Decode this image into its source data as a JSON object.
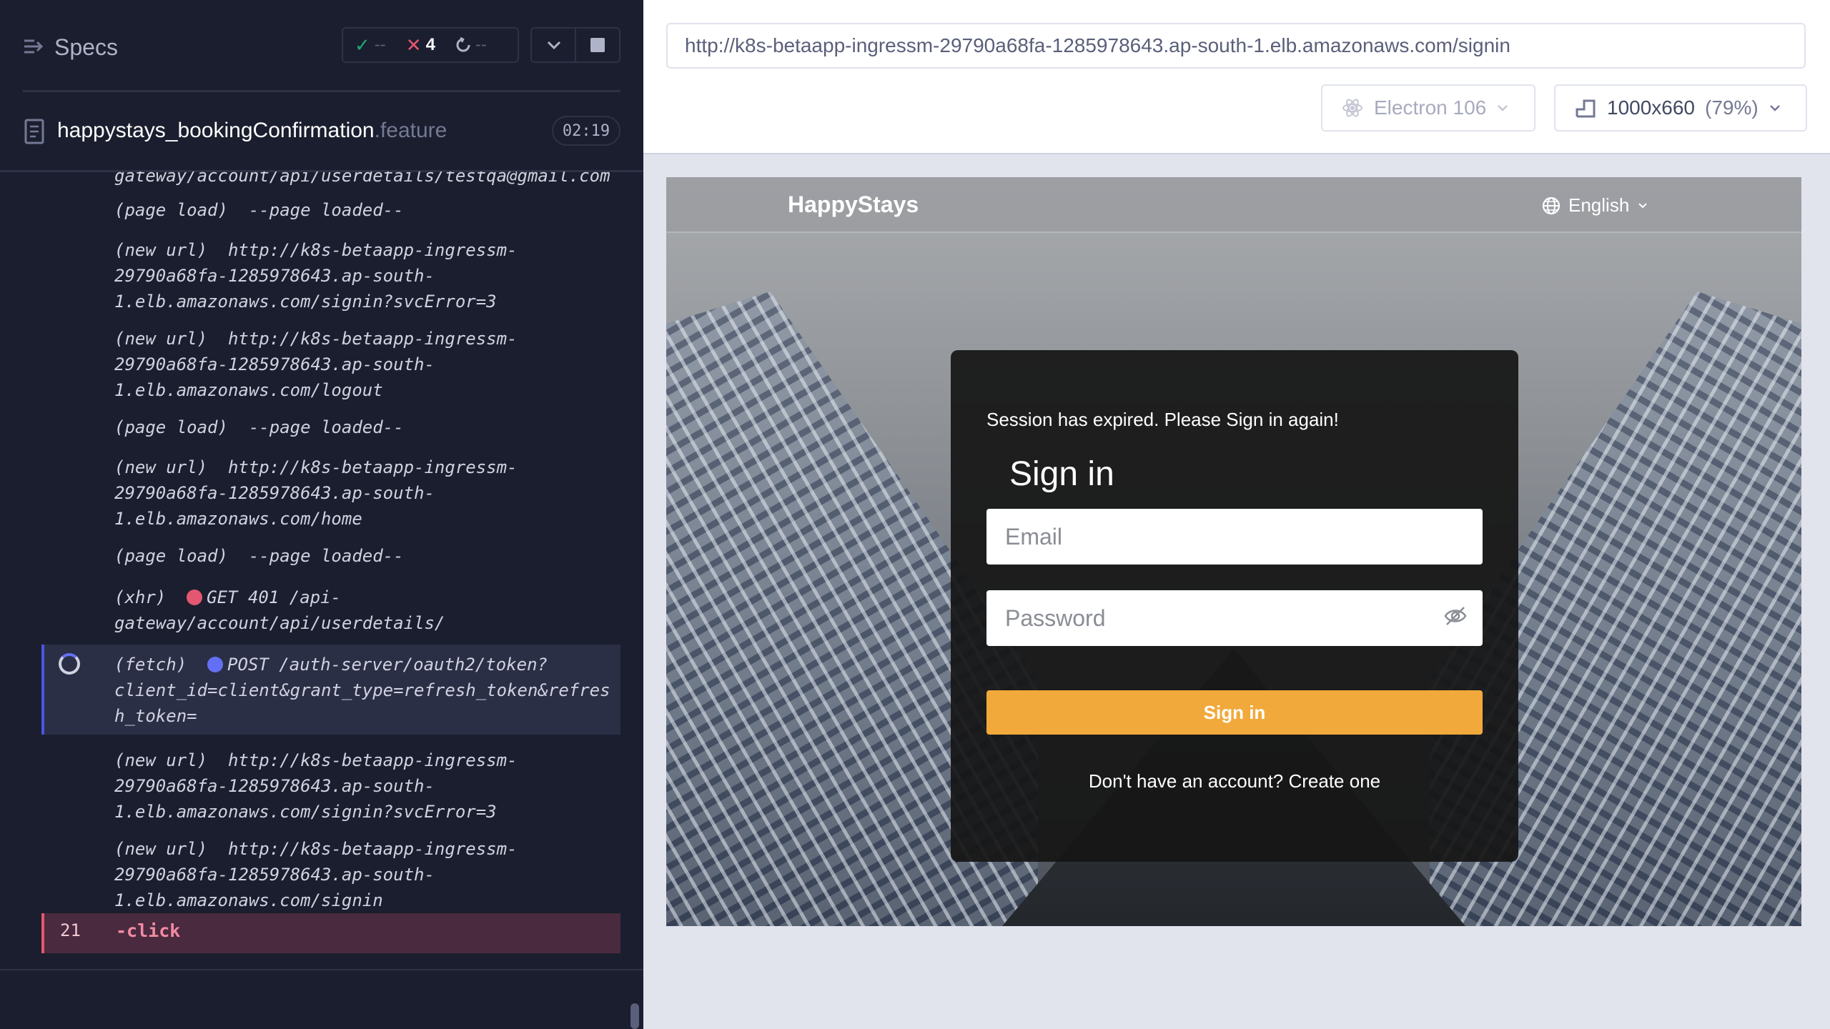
{
  "reporter": {
    "title": "Specs",
    "stats": {
      "passed": "--",
      "failed": "4",
      "pending": "--"
    },
    "spec": {
      "name": "happystays_bookingConfirmation",
      "ext": ".feature",
      "duration": "02:19"
    },
    "log": [
      {
        "text": "gateway/account/api/userdetails/testqa@gmail.com"
      },
      {
        "text": "(page load)  --page loaded--"
      },
      {
        "text": "(new url)  http://k8s-betaapp-ingressm-\n29790a68fa-1285978643.ap-south-\n1.elb.amazonaws.com/signin?svcError=3"
      },
      {
        "text": "(new url)  http://k8s-betaapp-ingressm-\n29790a68fa-1285978643.ap-south-\n1.elb.amazonaws.com/logout"
      },
      {
        "text": "(page load)  --page loaded--"
      },
      {
        "text": "(new url)  http://k8s-betaapp-ingressm-\n29790a68fa-1285978643.ap-south-\n1.elb.amazonaws.com/home"
      },
      {
        "text": "(page load)  --page loaded--"
      },
      {
        "prefix": "(xhr)  ",
        "text": "GET 401 /api-\ngateway/account/api/userdetails/"
      },
      {
        "prefix": "(fetch)  ",
        "text": "POST /auth-server/oauth2/token?\nclient_id=client&grant_type=refresh_token&refres\nh_token="
      },
      {
        "text": "(new url)  http://k8s-betaapp-ingressm-\n29790a68fa-1285978643.ap-south-\n1.elb.amazonaws.com/signin?svcError=3"
      },
      {
        "text": "(new url)  http://k8s-betaapp-ingressm-\n29790a68fa-1285978643.ap-south-\n1.elb.amazonaws.com/signin"
      }
    ],
    "current": {
      "line": "21",
      "command": "-click"
    }
  },
  "aut_header": {
    "url": "http://k8s-betaapp-ingressm-29790a68fa-1285978643.ap-south-1.elb.amazonaws.com/signin",
    "browser": "Electron 106",
    "viewport": "1000x660",
    "scale": "(79%)"
  },
  "app": {
    "brand": "HappyStays",
    "language": "English",
    "session_message": "Session has expired. Please Sign in again!",
    "heading": "Sign in",
    "email_placeholder": "Email",
    "password_placeholder": "Password",
    "submit_label": "Sign in",
    "signup_text": "Don't have an account? Create one"
  },
  "colors": {
    "reporter_bg": "#1b1e2e",
    "pass": "#1fa971",
    "fail": "#e45770",
    "accent_blue": "#6470f3",
    "signin_button": "#f2a93b"
  },
  "icons": [
    "specs-menu-icon",
    "check-icon",
    "x-icon",
    "refresh-icon",
    "chevron-down-icon",
    "stop-icon",
    "document-icon",
    "spinner-icon",
    "electron-icon",
    "viewport-icon",
    "globe-icon",
    "eye-off-icon"
  ]
}
